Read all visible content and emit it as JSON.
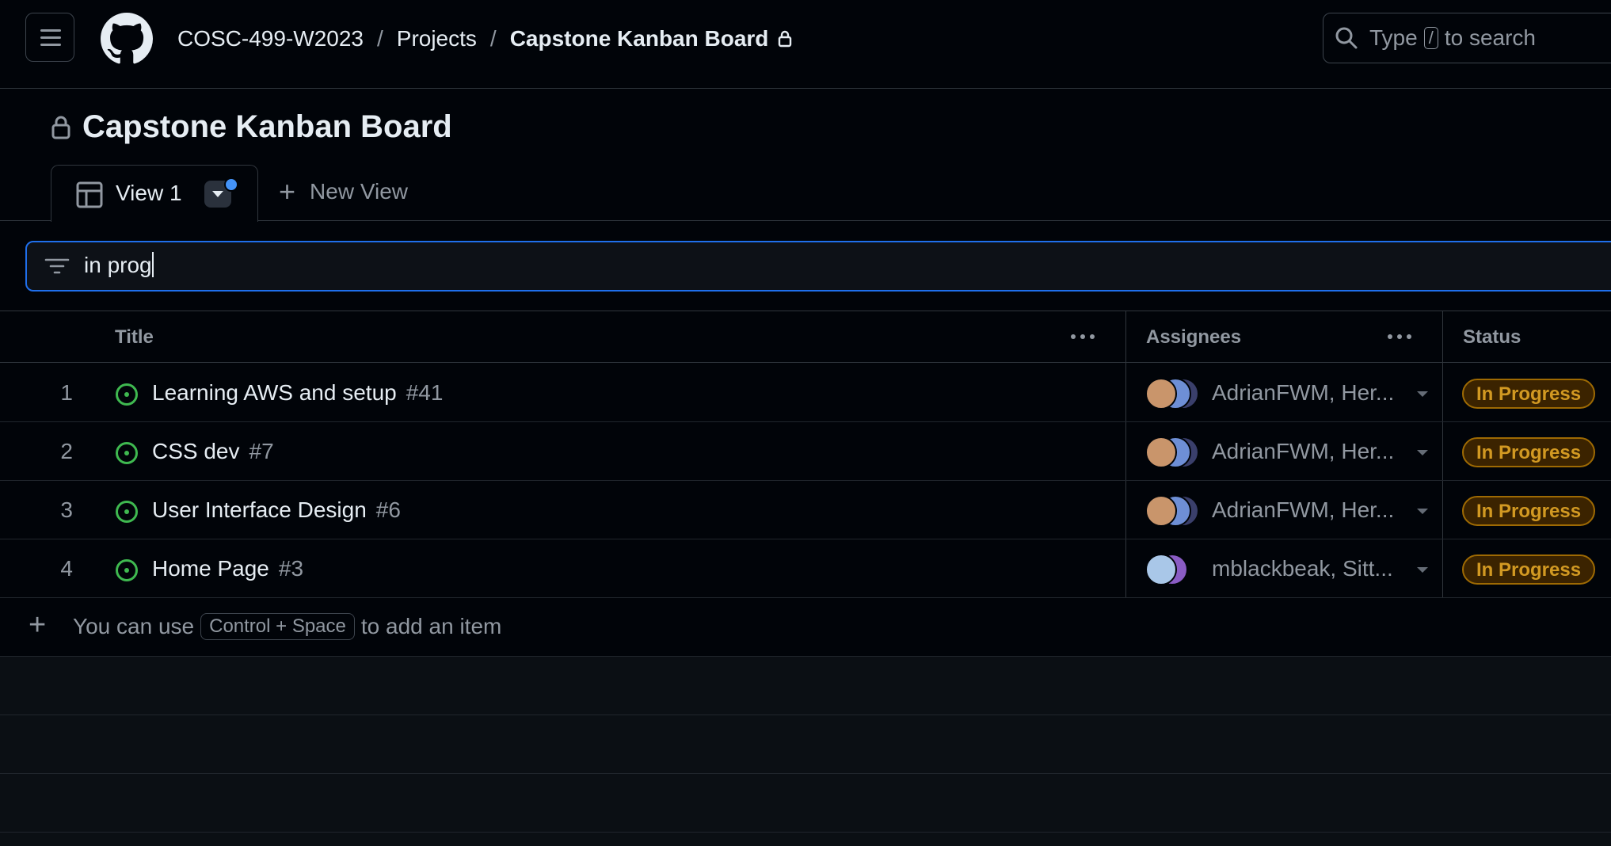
{
  "header": {
    "breadcrumbs": [
      "COSC-499-W2023",
      "Projects",
      "Capstone Kanban Board"
    ],
    "separator": "/",
    "search": {
      "prefix": "Type",
      "key": "/",
      "suffix": "to search"
    }
  },
  "project": {
    "title": "Capstone Kanban Board"
  },
  "views": {
    "active": "View 1",
    "new_view": "New View"
  },
  "filter": {
    "value": "in prog"
  },
  "table": {
    "columns": {
      "title": "Title",
      "assignees": "Assignees",
      "status": "Status"
    },
    "rows": [
      {
        "num": "1",
        "title": "Learning AWS and setup",
        "issue": "#41",
        "assignees": "AdrianFWM, Her...",
        "status": "In Progress"
      },
      {
        "num": "2",
        "title": "CSS dev",
        "issue": "#7",
        "assignees": "AdrianFWM, Her...",
        "status": "In Progress"
      },
      {
        "num": "3",
        "title": "User Interface Design",
        "issue": "#6",
        "assignees": "AdrianFWM, Her...",
        "status": "In Progress"
      },
      {
        "num": "4",
        "title": "Home Page",
        "issue": "#3",
        "assignees": "mblackbeak, Sitt...",
        "status": "In Progress"
      }
    ],
    "add_item": {
      "prefix": "You can use",
      "shortcut": "Control + Space",
      "suffix": "to add an item"
    }
  },
  "colors": {
    "background": "#010409",
    "accent_blue": "#1f6feb",
    "status_text": "#d29922",
    "open_issue_green": "#3fb950"
  }
}
